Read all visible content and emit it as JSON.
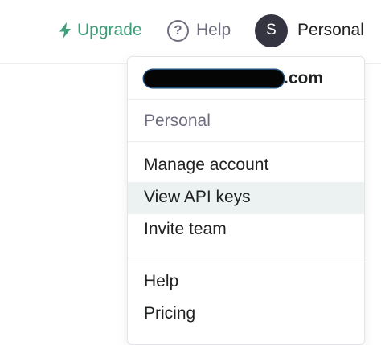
{
  "header": {
    "upgrade_label": "Upgrade",
    "help_label": "Help",
    "avatar_initial": "S",
    "account_label": "Personal"
  },
  "menu": {
    "email_suffix": ".com",
    "org_name": "Personal",
    "account_items": [
      {
        "label": "Manage account"
      },
      {
        "label": "View API keys",
        "highlighted": true
      },
      {
        "label": "Invite team"
      }
    ],
    "resource_items": [
      {
        "label": "Help"
      },
      {
        "label": "Pricing"
      }
    ]
  },
  "colors": {
    "accent_green": "#3f9e7a",
    "muted_text": "#6e6e80",
    "avatar_bg": "#343541",
    "highlight_bg": "#ecf2f2"
  },
  "icons": {
    "upgrade": "lightning-bolt-icon",
    "help": "question-circle-icon"
  }
}
